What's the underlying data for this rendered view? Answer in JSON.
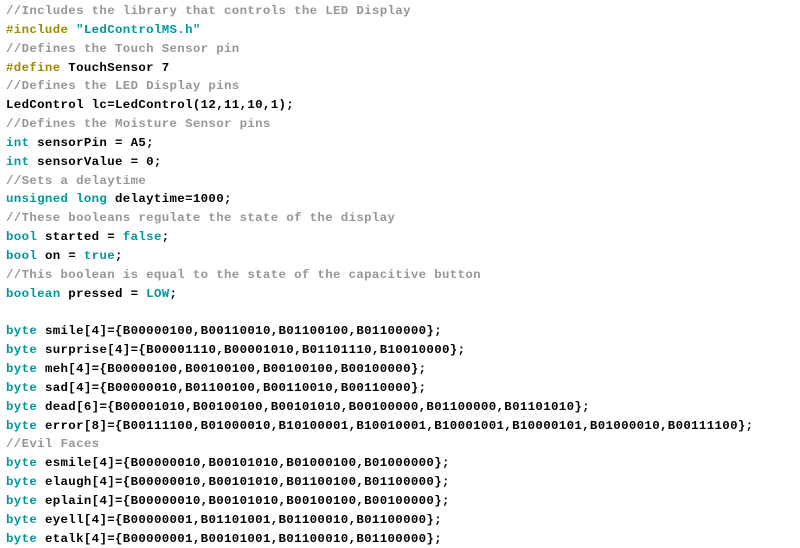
{
  "editor": {
    "background": "#ffffff",
    "default_text_color": "#000000",
    "colors": {
      "comment": "#969696",
      "preprocessor": "#9c8b00",
      "keyword": "#00979c",
      "string": "#00979c",
      "constant": "#00979c",
      "plain": "#000000"
    },
    "lines": [
      {
        "id": "line-1",
        "tokens": [
          {
            "type": "comment",
            "text": "//Includes the library that controls the LED Display"
          }
        ]
      },
      {
        "id": "line-2",
        "tokens": [
          {
            "type": "pre",
            "text": "#include"
          },
          {
            "type": "plain",
            "text": " "
          },
          {
            "type": "string",
            "text": "\"LedControlMS.h\""
          }
        ]
      },
      {
        "id": "line-3",
        "tokens": [
          {
            "type": "comment",
            "text": "//Defines the Touch Sensor pin"
          }
        ]
      },
      {
        "id": "line-4",
        "tokens": [
          {
            "type": "pre",
            "text": "#define"
          },
          {
            "type": "plain",
            "text": " TouchSensor 7"
          }
        ]
      },
      {
        "id": "line-5",
        "tokens": [
          {
            "type": "comment",
            "text": "//Defines the LED Display pins"
          }
        ]
      },
      {
        "id": "line-6",
        "tokens": [
          {
            "type": "plain",
            "text": "LedControl lc=LedControl(12,11,10,1);"
          }
        ]
      },
      {
        "id": "line-7",
        "tokens": [
          {
            "type": "comment",
            "text": "//Defines the Moisture Sensor pins"
          }
        ]
      },
      {
        "id": "line-8",
        "tokens": [
          {
            "type": "keyword",
            "text": "int"
          },
          {
            "type": "plain",
            "text": " sensorPin = A5;"
          }
        ]
      },
      {
        "id": "line-9",
        "tokens": [
          {
            "type": "keyword",
            "text": "int"
          },
          {
            "type": "plain",
            "text": " sensorValue = 0;"
          }
        ]
      },
      {
        "id": "line-10",
        "tokens": [
          {
            "type": "comment",
            "text": "//Sets a delaytime"
          }
        ]
      },
      {
        "id": "line-11",
        "tokens": [
          {
            "type": "keyword",
            "text": "unsigned long"
          },
          {
            "type": "plain",
            "text": " delaytime=1000;"
          }
        ]
      },
      {
        "id": "line-12",
        "tokens": [
          {
            "type": "comment",
            "text": "//These booleans regulate the state of the display"
          }
        ]
      },
      {
        "id": "line-13",
        "tokens": [
          {
            "type": "keyword",
            "text": "bool"
          },
          {
            "type": "plain",
            "text": " started = "
          },
          {
            "type": "const",
            "text": "false"
          },
          {
            "type": "plain",
            "text": ";"
          }
        ]
      },
      {
        "id": "line-14",
        "tokens": [
          {
            "type": "keyword",
            "text": "bool"
          },
          {
            "type": "plain",
            "text": " on = "
          },
          {
            "type": "const",
            "text": "true"
          },
          {
            "type": "plain",
            "text": ";"
          }
        ]
      },
      {
        "id": "line-15",
        "tokens": [
          {
            "type": "comment",
            "text": "//This boolean is equal to the state of the capacitive button"
          }
        ]
      },
      {
        "id": "line-16",
        "tokens": [
          {
            "type": "keyword",
            "text": "boolean"
          },
          {
            "type": "plain",
            "text": " pressed = "
          },
          {
            "type": "const",
            "text": "LOW"
          },
          {
            "type": "plain",
            "text": ";"
          }
        ]
      },
      {
        "id": "line-17",
        "blank": true,
        "tokens": []
      },
      {
        "id": "line-18",
        "tokens": [
          {
            "type": "keyword",
            "text": "byte"
          },
          {
            "type": "plain",
            "text": " smile[4]={B00000100,B00110010,B01100100,B01100000};"
          }
        ]
      },
      {
        "id": "line-19",
        "tokens": [
          {
            "type": "keyword",
            "text": "byte"
          },
          {
            "type": "plain",
            "text": " surprise[4]={B00001110,B00001010,B01101110,B10010000};"
          }
        ]
      },
      {
        "id": "line-20",
        "tokens": [
          {
            "type": "keyword",
            "text": "byte"
          },
          {
            "type": "plain",
            "text": " meh[4]={B00000100,B00100100,B00100100,B00100000};"
          }
        ]
      },
      {
        "id": "line-21",
        "tokens": [
          {
            "type": "keyword",
            "text": "byte"
          },
          {
            "type": "plain",
            "text": " sad[4]={B00000010,B01100100,B00110010,B00110000};"
          }
        ]
      },
      {
        "id": "line-22",
        "tokens": [
          {
            "type": "keyword",
            "text": "byte"
          },
          {
            "type": "plain",
            "text": " dead[6]={B00001010,B00100100,B00101010,B00100000,B01100000,B01101010};"
          }
        ]
      },
      {
        "id": "line-23",
        "tokens": [
          {
            "type": "keyword",
            "text": "byte"
          },
          {
            "type": "plain",
            "text": " error[8]={B00111100,B01000010,B10100001,B10010001,B10001001,B10000101,B01000010,B00111100};"
          }
        ]
      },
      {
        "id": "line-24",
        "tokens": [
          {
            "type": "comment",
            "text": "//Evil Faces"
          }
        ]
      },
      {
        "id": "line-25",
        "tokens": [
          {
            "type": "keyword",
            "text": "byte"
          },
          {
            "type": "plain",
            "text": " esmile[4]={B00000010,B00101010,B01000100,B01000000};"
          }
        ]
      },
      {
        "id": "line-26",
        "tokens": [
          {
            "type": "keyword",
            "text": "byte"
          },
          {
            "type": "plain",
            "text": " elaugh[4]={B00000010,B00101010,B01100100,B01100000};"
          }
        ]
      },
      {
        "id": "line-27",
        "tokens": [
          {
            "type": "keyword",
            "text": "byte"
          },
          {
            "type": "plain",
            "text": " eplain[4]={B00000010,B00101010,B00100100,B00100000};"
          }
        ]
      },
      {
        "id": "line-28",
        "tokens": [
          {
            "type": "keyword",
            "text": "byte"
          },
          {
            "type": "plain",
            "text": " eyell[4]={B00000001,B01101001,B01100010,B01100000};"
          }
        ]
      },
      {
        "id": "line-29",
        "tokens": [
          {
            "type": "keyword",
            "text": "byte"
          },
          {
            "type": "plain",
            "text": " etalk[4]={B00000001,B00101001,B01100010,B01100000};"
          }
        ]
      }
    ]
  }
}
